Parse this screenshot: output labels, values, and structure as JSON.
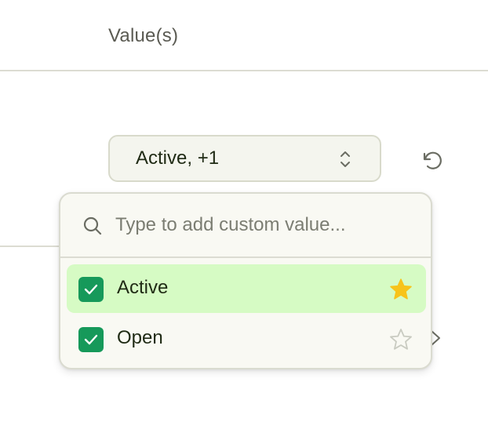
{
  "table": {
    "column_header": "Value(s)"
  },
  "select": {
    "value": "Active, +1",
    "icon": "chevron-up-down-icon"
  },
  "reset": {
    "icon": "reset-icon"
  },
  "popover": {
    "search": {
      "placeholder": "Type to add custom value...",
      "value": "",
      "icon": "search-icon"
    },
    "options": [
      {
        "label": "Active",
        "checked": true,
        "starred": true,
        "highlighted": true
      },
      {
        "label": "Open",
        "checked": true,
        "starred": false,
        "highlighted": false
      }
    ]
  },
  "colors": {
    "checkbox": "#16995a",
    "highlight": "#d6fbc4",
    "star_filled": "#f7c31a",
    "star_outline": "#c9cbc1",
    "popover_bg": "#f9f9f3",
    "select_bg": "#f4f5ee"
  }
}
